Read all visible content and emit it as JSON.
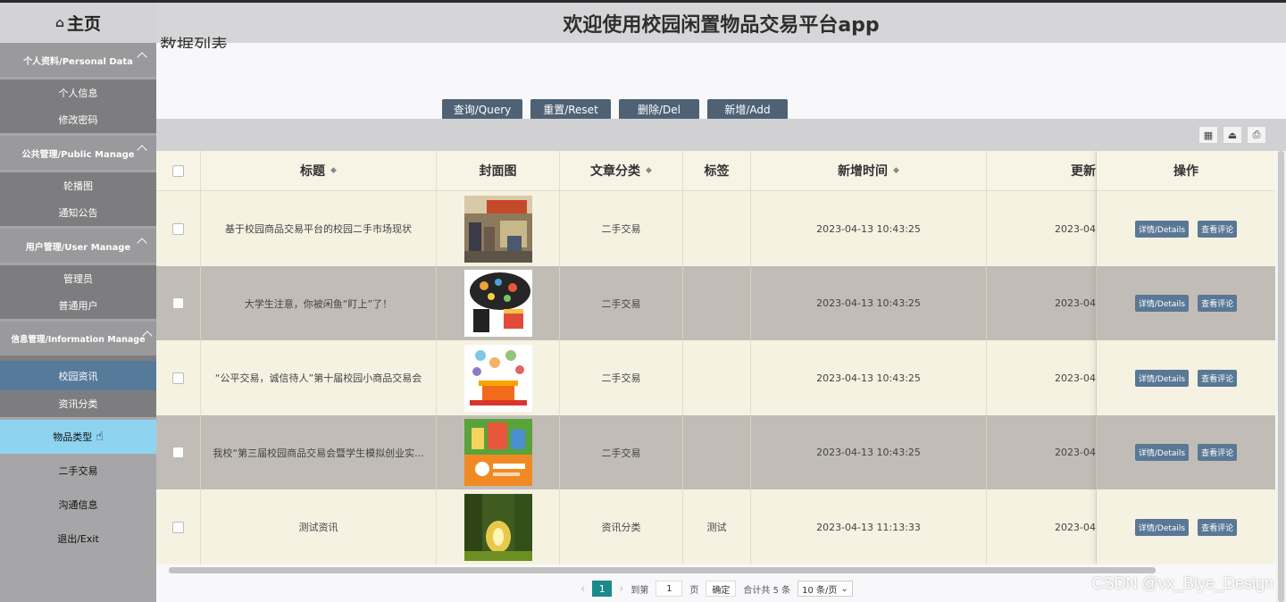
{
  "header": {
    "title": "欢迎使用校园闲置物品交易平台app"
  },
  "sidebar": {
    "home": "主页",
    "groups": [
      {
        "label": "个人资料/Personal Data",
        "items": [
          "个人信息",
          "修改密码"
        ]
      },
      {
        "label": "公共管理/Public Manage",
        "items": [
          "轮播图",
          "通知公告"
        ]
      },
      {
        "label": "用户管理/User Manage",
        "items": [
          "管理员",
          "普通用户"
        ]
      },
      {
        "label": "信息管理/Information Manage",
        "items": [
          "校园资讯",
          "资讯分类"
        ]
      }
    ],
    "extra_items": [
      "物品类型",
      "二手交易",
      "沟通信息",
      "退出/Exit"
    ]
  },
  "page": {
    "cut_title": "数据列表"
  },
  "buttons": {
    "query": "查询/Query",
    "reset": "重置/Reset",
    "delete": "删除/Del",
    "add": "新增/Add"
  },
  "table": {
    "columns": [
      "标题",
      "封面图",
      "文章分类",
      "标签",
      "新增时间",
      "更新",
      "操作"
    ],
    "rows": [
      {
        "title": "基于校园商品交易平台的校园二手市场现状",
        "category": "二手交易",
        "tag": "",
        "created": "2023-04-13 10:43:25",
        "updated": "2023-04"
      },
      {
        "title": "大学生注意，你被闲鱼“盯上”了！",
        "category": "二手交易",
        "tag": "",
        "created": "2023-04-13 10:43:25",
        "updated": "2023-04"
      },
      {
        "title": "“公平交易，诚信待人”第十届校园小商品交易会",
        "category": "二手交易",
        "tag": "",
        "created": "2023-04-13 10:43:25",
        "updated": "2023-04"
      },
      {
        "title": "我校“第三届校园商品交易会暨学生模拟创业实...",
        "category": "二手交易",
        "tag": "",
        "created": "2023-04-13 10:43:25",
        "updated": "2023-04"
      },
      {
        "title": "测试资讯",
        "category": "资讯分类",
        "tag": "测试",
        "created": "2023-04-13 11:13:33",
        "updated": "2023-04"
      }
    ],
    "actions": {
      "details": "详情/Details",
      "comments": "查看评论"
    }
  },
  "pager": {
    "current": "1",
    "goto_label": "到第",
    "goto_value": "1",
    "page_unit": "页",
    "confirm": "确定",
    "total": "合计共 5 条",
    "page_size": "10 条/页"
  },
  "watermark": "CSDN @vx_Biye_Design"
}
